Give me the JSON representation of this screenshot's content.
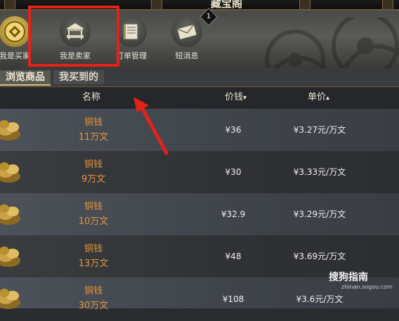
{
  "window": {
    "title": "藏宝阁"
  },
  "toolbar": {
    "buttons": [
      {
        "label": "我是买家",
        "icon": "coin-icon",
        "active": true
      },
      {
        "label": "我是卖家",
        "icon": "stall-icon",
        "active": false
      },
      {
        "label": "订单管理",
        "icon": "ledger-icon",
        "active": false
      },
      {
        "label": "短消息",
        "icon": "envelope-icon",
        "active": false
      }
    ],
    "message_badge": "1"
  },
  "tabs": [
    {
      "label": "浏览商品",
      "active": true
    },
    {
      "label": "我买到的",
      "active": false
    }
  ],
  "table": {
    "headers": {
      "name": "名称",
      "price": "价钱",
      "price_sort": "▾",
      "unit_price": "单价",
      "unit_price_sort": "▴"
    },
    "rows": [
      {
        "item": "铜钱",
        "qty": "11万文",
        "price": "¥36",
        "unit": "¥3.27元/万文"
      },
      {
        "item": "铜钱",
        "qty": "9万文",
        "price": "¥30",
        "unit": "¥3.33元/万文"
      },
      {
        "item": "铜钱",
        "qty": "10万文",
        "price": "¥32.9",
        "unit": "¥3.29元/万文"
      },
      {
        "item": "铜钱",
        "qty": "13万文",
        "price": "¥48",
        "unit": "¥3.69元/万文"
      },
      {
        "item": "铜钱",
        "qty": "30万文",
        "price": "¥108",
        "unit": "¥3.6元/万文"
      }
    ]
  },
  "watermark": {
    "brand": "搜狗指南",
    "url": "zhinan.sogou.com"
  },
  "colors": {
    "highlight_box": "#e2231a",
    "item_name": "#e2943a",
    "gold": "#d8c27a"
  }
}
